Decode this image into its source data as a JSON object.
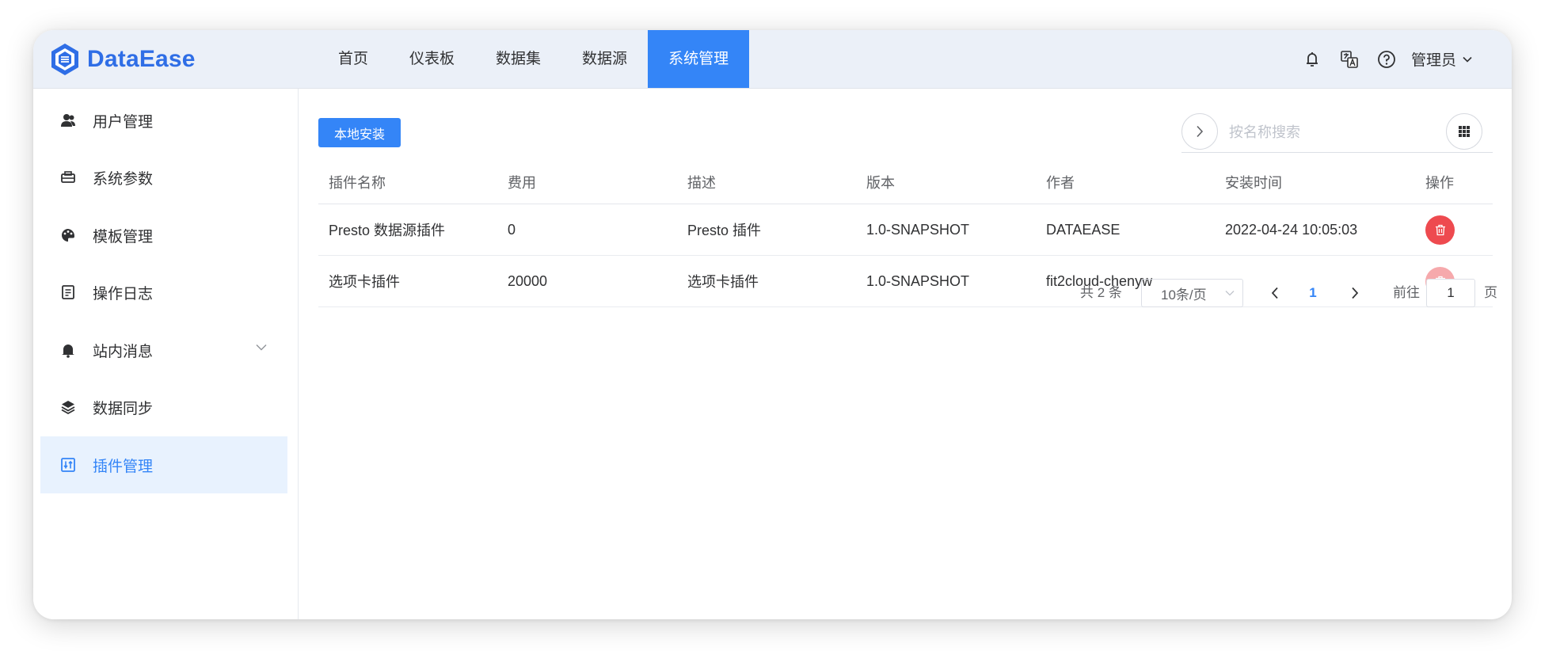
{
  "app": {
    "name": "DataEase"
  },
  "nav": {
    "items": [
      {
        "label": "首页"
      },
      {
        "label": "仪表板"
      },
      {
        "label": "数据集"
      },
      {
        "label": "数据源"
      },
      {
        "label": "系统管理",
        "active": true
      }
    ]
  },
  "header": {
    "user_label": "管理员",
    "icons": [
      "bell-icon",
      "translate-icon",
      "help-icon"
    ]
  },
  "sidebar": {
    "items": [
      {
        "label": "用户管理",
        "icon": "user-icon"
      },
      {
        "label": "系统参数",
        "icon": "settings-icon"
      },
      {
        "label": "模板管理",
        "icon": "palette-icon"
      },
      {
        "label": "操作日志",
        "icon": "log-icon"
      },
      {
        "label": "站内消息",
        "icon": "bell-icon",
        "expandable": true
      },
      {
        "label": "数据同步",
        "icon": "layers-icon"
      },
      {
        "label": "插件管理",
        "icon": "plugin-icon",
        "active": true
      }
    ]
  },
  "toolbar": {
    "install_label": "本地安装",
    "search_placeholder": "按名称搜索"
  },
  "table": {
    "columns": [
      "插件名称",
      "费用",
      "描述",
      "版本",
      "作者",
      "安装时间",
      "操作"
    ],
    "rows": [
      {
        "name": "Presto 数据源插件",
        "cost": "0",
        "desc": "Presto 插件",
        "version": "1.0-SNAPSHOT",
        "author": "DATAEASE",
        "installed": "2022-04-24 10:05:03",
        "delete_enabled": true
      },
      {
        "name": "选项卡插件",
        "cost": "20000",
        "desc": "选项卡插件",
        "version": "1.0-SNAPSHOT",
        "author": "fit2cloud-chenyw",
        "installed": "",
        "delete_enabled": false
      }
    ]
  },
  "pagination": {
    "total_label": "共 2 条",
    "page_size": "10条/页",
    "current_page": "1",
    "goto_label": "前往",
    "goto_value": "1",
    "page_unit": "页"
  },
  "colors": {
    "accent": "#3485f7",
    "danger": "#ee4a4f",
    "danger_disabled": "#f6a9ac",
    "header_bg": "#ebf0f8"
  }
}
